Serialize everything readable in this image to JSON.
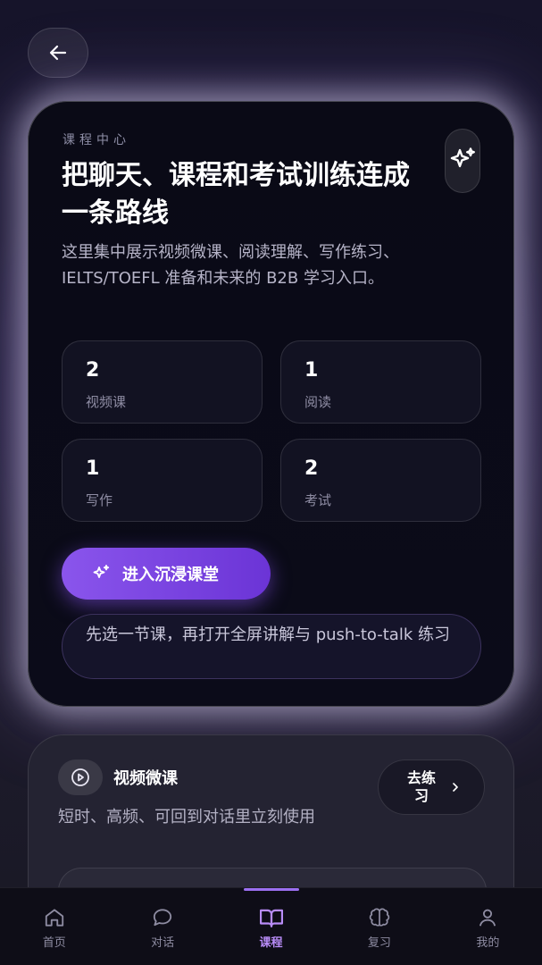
{
  "hero": {
    "eyebrow": "课程中心",
    "title": "把聊天、课程和考试训练连成一条路线",
    "description": "这里集中展示视频微课、阅读理解、写作练习、IELTS/TOEFL 准备和未来的 B2B 学习入口。",
    "stats": [
      {
        "value": "2",
        "label": "视频课"
      },
      {
        "value": "1",
        "label": "阅读"
      },
      {
        "value": "1",
        "label": "写作"
      },
      {
        "value": "2",
        "label": "考试"
      }
    ],
    "cta_label": "进入沉浸课堂",
    "hint": "先选一节课，再打开全屏讲解与 push-to-talk 练习"
  },
  "course": {
    "title": "视频微课",
    "description": "短时、高频、可回到对话里立刻使用",
    "go_label": "去练习"
  },
  "tabbar": {
    "items": [
      {
        "label": "首页",
        "icon": "home-icon"
      },
      {
        "label": "对话",
        "icon": "chat-bubble-icon"
      },
      {
        "label": "课程",
        "icon": "book-icon"
      },
      {
        "label": "复习",
        "icon": "brain-icon"
      },
      {
        "label": "我的",
        "icon": "user-icon"
      }
    ],
    "active": "课程"
  },
  "colors": {
    "accent": "#8a55ec",
    "active_tab": "#b88cf7"
  }
}
